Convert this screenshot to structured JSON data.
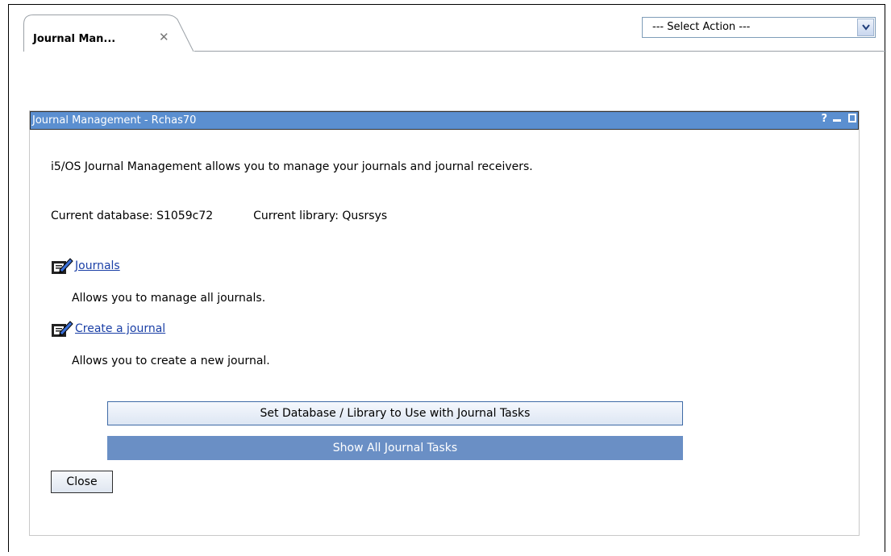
{
  "tab": {
    "label": "Journal Man...",
    "close_glyph": "✕"
  },
  "action_select": {
    "selected": "--- Select Action ---"
  },
  "portlet": {
    "title": "Journal Management - Rchas70",
    "help_glyph": "?",
    "description": "i5/OS Journal Management allows you to manage your journals and journal receivers.",
    "current_database": "Current database: S1059c72",
    "current_library": "Current library: Qusrsys",
    "tasks": [
      {
        "label": "Journals",
        "description": "Allows you to manage all journals.",
        "icon": "journal-edit-icon"
      },
      {
        "label": "Create a journal",
        "description": "Allows you to create a new journal.",
        "icon": "journal-edit-icon"
      }
    ],
    "set_button": "Set Database / Library to Use with Journal Tasks",
    "show_button": "Show All Journal Tasks",
    "close_button": "Close"
  },
  "colors": {
    "title_bar": "#5b8fd0",
    "show_button": "#6a8fc5",
    "link": "#1a3fa6"
  }
}
